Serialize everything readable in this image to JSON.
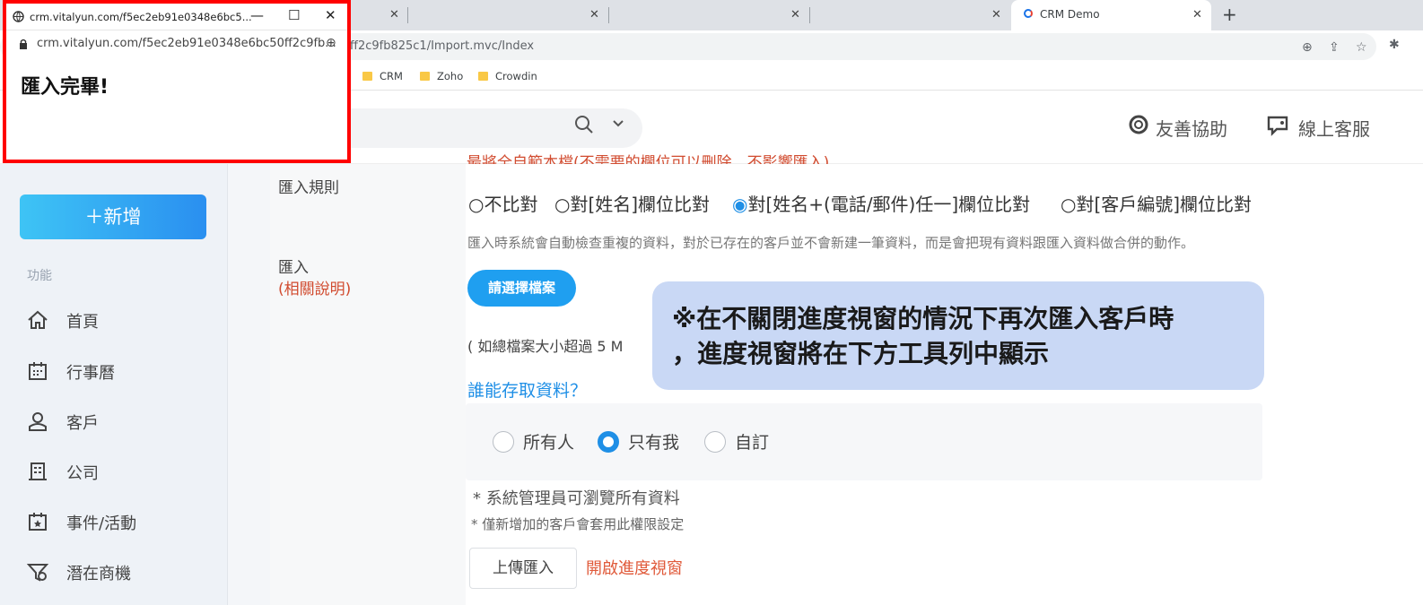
{
  "browser": {
    "tabs": [
      {
        "label": ""
      },
      {
        "label": ""
      },
      {
        "label": ""
      },
      {
        "label": ""
      },
      {
        "label": "CRM Demo"
      }
    ],
    "new_tab_label": "+",
    "url": "ff2c9fb825c1/Import.mvc/Index",
    "bookmarks": [
      {
        "label": "CRM"
      },
      {
        "label": "Zoho"
      },
      {
        "label": "Crowdin"
      }
    ]
  },
  "popup": {
    "title": "crm.vitalyun.com/f5ec2eb91e0348e6bc5...",
    "url": "crm.vitalyun.com/f5ec2eb91e0348e6bc50ff2c9fb...",
    "message": "匯入完畢!"
  },
  "header": {
    "help_label": "友善協助",
    "support_label": "線上客服"
  },
  "sidebar": {
    "new_button": "＋新增",
    "section_label": "功能",
    "items": [
      {
        "label": "首頁",
        "icon": "home-icon"
      },
      {
        "label": "行事曆",
        "icon": "calendar-icon"
      },
      {
        "label": "客戶",
        "icon": "customer-icon"
      },
      {
        "label": "公司",
        "icon": "building-icon"
      },
      {
        "label": "事件/活動",
        "icon": "event-icon"
      },
      {
        "label": "潛在商機",
        "icon": "funnel-icon"
      }
    ]
  },
  "form": {
    "partial_top_text": "最將全自範本檔(不需要的欄位可以刪除，不影響匯入)",
    "rule_label": "匯入規則",
    "rule_options": [
      {
        "label": "不比對",
        "selected": false
      },
      {
        "label": "對[姓名]欄位比對",
        "selected": false
      },
      {
        "label": "對[姓名+(電話/郵件)任一]欄位比對",
        "selected": true
      },
      {
        "label": "對[客戶編號]欄位比對",
        "selected": false
      }
    ],
    "dup_note": "匯入時系統會自動檢查重複的資料，對於已存在的客戶並不會新建一筆資料，而是會把現有資料跟匯入資料做合併的動作。",
    "import_label": "匯入",
    "help_link": "(相關說明)",
    "choose_file_button": "請選擇檔案",
    "size_note": "( 如總檔案大小超過 5 M",
    "who_link": "誰能存取資料？",
    "permissions": [
      {
        "label": "所有人",
        "selected": false
      },
      {
        "label": "只有我",
        "selected": true
      },
      {
        "label": "自訂",
        "selected": false
      }
    ],
    "admin_note": "*  系統管理員可瀏覽所有資料",
    "new_note": "*  僅新增加的客戶會套用此權限設定",
    "upload_button": "上傳匯入",
    "open_progress_link": "開啟進度視窗"
  },
  "callout": {
    "text": "※在不關閉進度視窗的情況下再次匯入客戶時\n，進度視窗將在下方工具列中顯示"
  },
  "colors": {
    "accent": "#1f8fe6",
    "warning_text": "#e05a3a",
    "callout_bg": "#c9d8f5",
    "highlight_border": "#ff0000"
  }
}
